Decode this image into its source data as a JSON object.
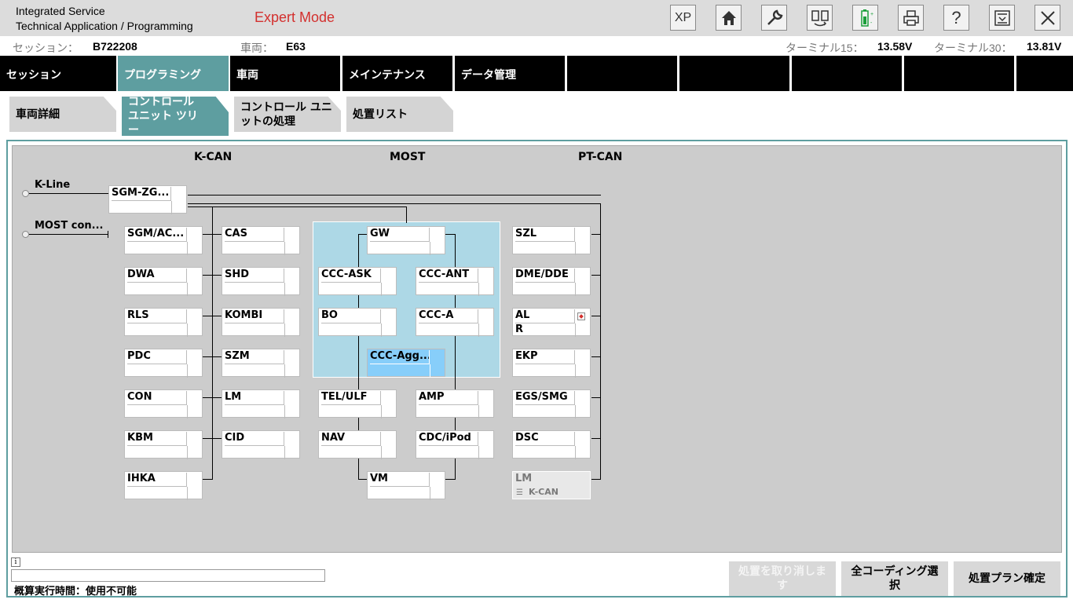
{
  "header": {
    "app_line1": "Integrated Service",
    "app_line2": "Technical Application / Programming",
    "mode": "Expert Mode",
    "toolbar": [
      {
        "name": "xp-button",
        "label": "XP"
      },
      {
        "name": "home-icon",
        "label": ""
      },
      {
        "name": "wrench-icon",
        "label": ""
      },
      {
        "name": "transfer-icon",
        "label": ""
      },
      {
        "name": "battery-icon",
        "label": ""
      },
      {
        "name": "print-icon",
        "label": ""
      },
      {
        "name": "help-icon",
        "label": "?"
      },
      {
        "name": "menu-icon",
        "label": ""
      },
      {
        "name": "close-icon",
        "label": ""
      }
    ]
  },
  "infobar": {
    "session_label": "セッション：",
    "session_value": "B722208",
    "vehicle_label": "車両：",
    "vehicle_value": "E63",
    "t15_label": "ターミナル15：",
    "t15_value": "13.58V",
    "t30_label": "ターミナル30：",
    "t30_value": "13.81V"
  },
  "nav": {
    "tabs": [
      "セッション",
      "プログラミング",
      "車両",
      "メインテナンス",
      "データ管理",
      "",
      "",
      "",
      "",
      ""
    ],
    "active": 1
  },
  "subtabs": {
    "items": [
      "車両詳細",
      "コントロール ユニット ツリー",
      "コントロール ユニットの処理",
      "処置リスト"
    ],
    "active": 1
  },
  "diagram": {
    "buses": {
      "kcan": "K-CAN",
      "most": "MOST",
      "ptcan": "PT-CAN"
    },
    "kline_label": "K-Line",
    "most_con_label": "MOST con...",
    "gateway": "SGM-ZG...",
    "ecus": {
      "col1": [
        "SGM/AC...",
        "DWA",
        "RLS",
        "PDC",
        "CON",
        "KBM",
        "IHKA"
      ],
      "col2": [
        "CAS",
        "SHD",
        "KOMBI",
        "SZM",
        "LM",
        "CID"
      ],
      "most_inner": [
        "GW",
        "CCC-ASK",
        "CCC-ANT",
        "BO",
        "CCC-A",
        "CCC-Agg..."
      ],
      "most_outer": [
        "TEL/ULF",
        "AMP",
        "NAV",
        "CDC/iPod",
        "VM"
      ],
      "col5": [
        "SZL",
        "DME/DDE",
        "AL",
        "EKP",
        "EGS/SMG",
        "DSC"
      ],
      "al_extra": "R",
      "lm_disabled": {
        "name": "LM",
        "sub": "K-CAN"
      }
    }
  },
  "footer": {
    "info_glyph": "i",
    "runtime": "概算実行時間：使用不可能",
    "cancel": "処置を取り消します",
    "select_all": "全コーディング選択",
    "confirm": "処置プラン確定"
  }
}
